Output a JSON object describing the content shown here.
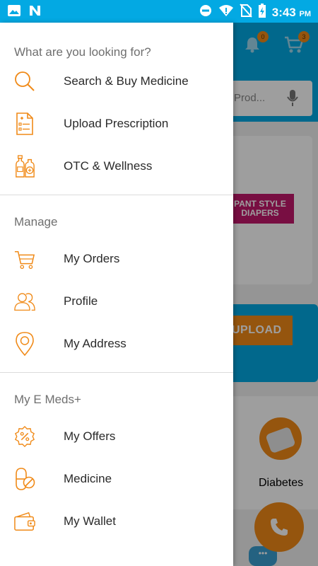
{
  "status_bar": {
    "time": "3:43",
    "ampm": "PM",
    "icons": [
      "image-icon",
      "n-icon",
      "do-not-disturb-icon",
      "wifi-icon",
      "no-sim-icon",
      "battery-charging-icon"
    ]
  },
  "background_app": {
    "cart_badge": "0",
    "bag_badge": "3",
    "search_placeholder": "C Prod...",
    "promo_text_1": "PANT STYLE",
    "promo_text_2": "DIAPERS",
    "upload_label": "UPLOAD",
    "category_label": "Diabetes",
    "chat_text": "•••"
  },
  "drawer": {
    "sections": [
      {
        "title": "What are you looking for?",
        "items": [
          {
            "label": "Search & Buy Medicine",
            "icon": "search-icon"
          },
          {
            "label": "Upload Prescription",
            "icon": "prescription-icon"
          },
          {
            "label": "OTC & Wellness",
            "icon": "wellness-bottles-icon"
          }
        ]
      },
      {
        "title": "Manage",
        "items": [
          {
            "label": "My Orders",
            "icon": "cart-icon"
          },
          {
            "label": "Profile",
            "icon": "profile-icon"
          },
          {
            "label": "My Address",
            "icon": "location-pin-icon"
          }
        ]
      },
      {
        "title": "My E Meds+",
        "items": [
          {
            "label": "My Offers",
            "icon": "offer-badge-icon"
          },
          {
            "label": "Medicine",
            "icon": "pill-icon"
          },
          {
            "label": "My Wallet",
            "icon": "wallet-icon"
          }
        ]
      }
    ]
  },
  "colors": {
    "accent": "#f08a18",
    "brand_blue": "#03a9e3",
    "section_title": "#6f6f6f",
    "item_text": "#2a2a2a"
  }
}
